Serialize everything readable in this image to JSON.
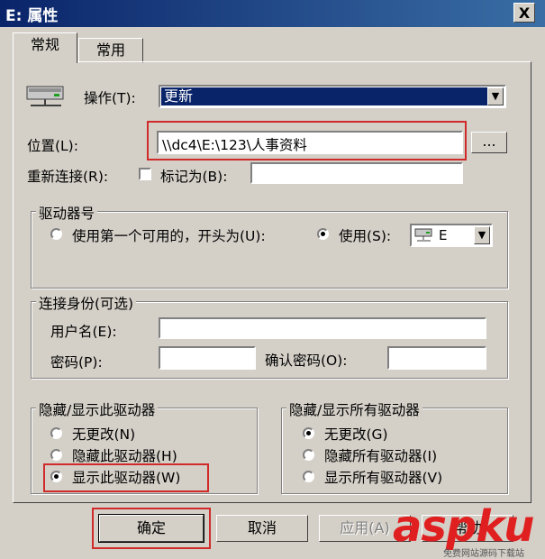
{
  "window": {
    "title": "E: 属性",
    "close": "X"
  },
  "tabs": [
    {
      "label": "常规"
    },
    {
      "label": "常用"
    }
  ],
  "action": {
    "label": "操作(T):",
    "value": "更新"
  },
  "location": {
    "label": "位置(L):",
    "value": "\\\\dc4\\E:\\123\\人事资料",
    "browse": "..."
  },
  "reconnect": {
    "label": "重新连接(R):",
    "tag_label": "标记为(B):",
    "tag_value": ""
  },
  "drive_letter": {
    "title": "驱动器号",
    "first_available": "使用第一个可用的，开头为(U):",
    "use": "使用(S):",
    "drive_value": "E"
  },
  "connect_as": {
    "title": "连接身份(可选)",
    "username": "用户名(E):",
    "password": "密码(P):",
    "confirm_password": "确认密码(O):"
  },
  "hide_show_this": {
    "title": "隐藏/显示此驱动器",
    "options": [
      "无更改(N)",
      "隐藏此驱动器(H)",
      "显示此驱动器(W)"
    ],
    "selected": 2
  },
  "hide_show_all": {
    "title": "隐藏/显示所有驱动器",
    "options": [
      "无更改(G)",
      "隐藏所有驱动器(I)",
      "显示所有驱动器(V)"
    ],
    "selected": 0
  },
  "buttons": {
    "ok": "确定",
    "cancel": "取消",
    "apply": "应用(A)",
    "help": "帮助"
  },
  "watermark": {
    "brand": "aspku",
    "sub": "免费网站源码下载站"
  }
}
